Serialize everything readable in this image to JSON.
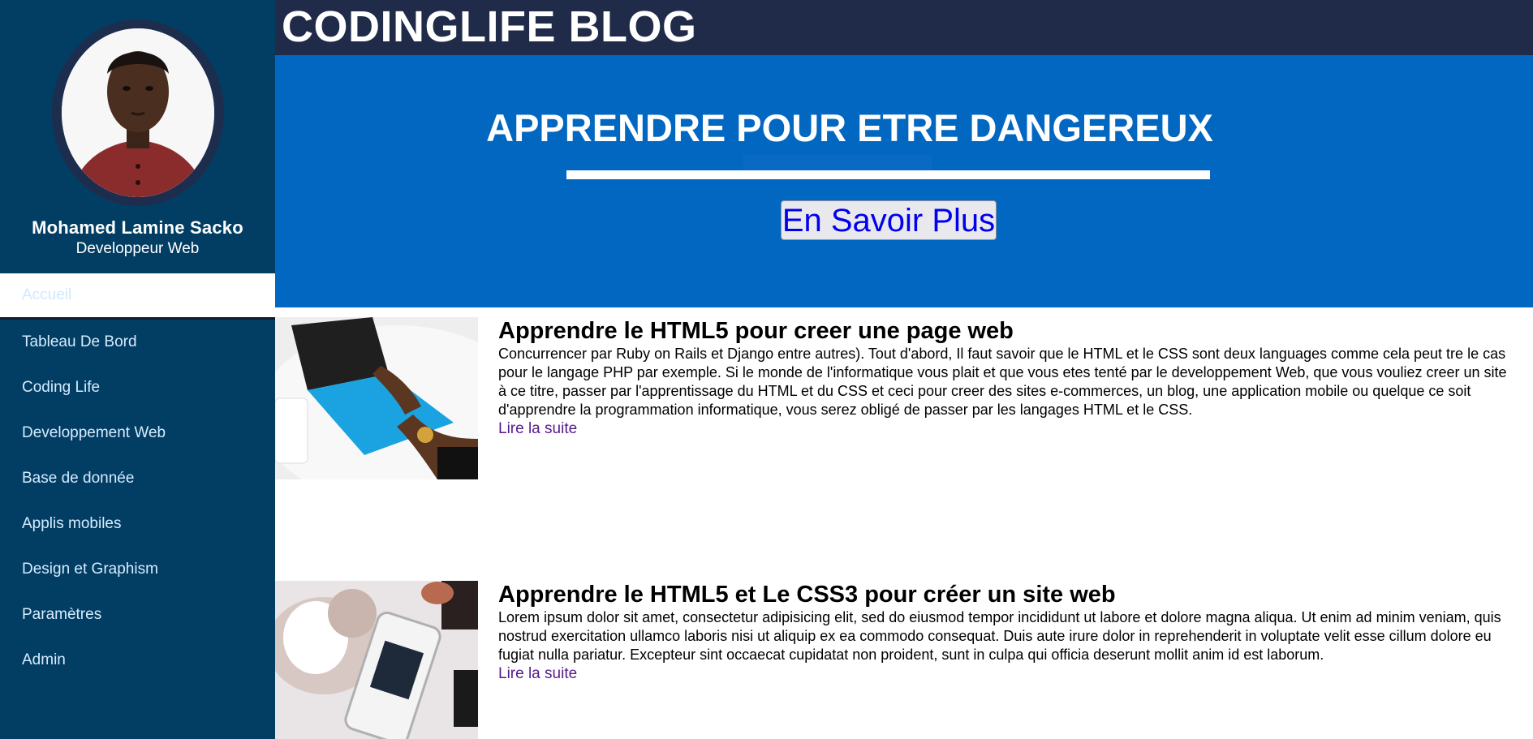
{
  "profile": {
    "name": "Mohamed Lamine Sacko",
    "role": "Developpeur Web"
  },
  "sidebar": {
    "items": [
      {
        "label": "Accueil",
        "active": true
      },
      {
        "label": "Tableau De Bord"
      },
      {
        "label": "Coding Life"
      },
      {
        "label": "Developpement Web"
      },
      {
        "label": "Base de donnée"
      },
      {
        "label": "Applis mobiles"
      },
      {
        "label": "Design et Graphism"
      },
      {
        "label": "Paramètres"
      },
      {
        "label": "Admin"
      }
    ]
  },
  "header": {
    "title": "CODINGLIFE BLOG"
  },
  "hero": {
    "title": "APPRENDRE POUR ETRE DANGEREUX",
    "button_label": "En Savoir Plus"
  },
  "articles": [
    {
      "title": "Apprendre le HTML5 pour creer une page web",
      "text": "Concurrencer par Ruby on Rails et Django entre autres). Tout d'abord, Il faut savoir que le HTML et le CSS sont deux languages comme cela peut tre le cas pour le langage PHP par exemple. Si le monde de l'informatique vous plait et que vous etes tenté par le developpement Web, que vous vouliez creer un site à ce titre, passer par l'apprentissage du HTML et du CSS et ceci pour creer des sites e-commerces, un blog, une application mobile ou quelque ce soit d'apprendre la programmation informatique, vous serez obligé de passer par les langages HTML et le CSS.",
      "link": "Lire la suite"
    },
    {
      "title": "Apprendre le HTML5 et Le CSS3 pour créer un site web",
      "text": "Lorem ipsum dolor sit amet, consectetur adipisicing elit, sed do eiusmod tempor incididunt ut labore et dolore magna aliqua. Ut enim ad minim veniam, quis nostrud exercitation ullamco laboris nisi ut aliquip ex ea commodo consequat. Duis aute irure dolor in reprehenderit in voluptate velit esse cillum dolore eu fugiat nulla pariatur. Excepteur sint occaecat cupidatat non proident, sunt in culpa qui officia deserunt mollit anim id est laborum.",
      "link": "Lire la suite"
    }
  ],
  "colors": {
    "sidebar_bg": "#023e63",
    "header_bg": "#1f2b48",
    "hero_bg": "#0267c1",
    "link_visited": "#551a8b",
    "button_text": "#0000ee"
  }
}
